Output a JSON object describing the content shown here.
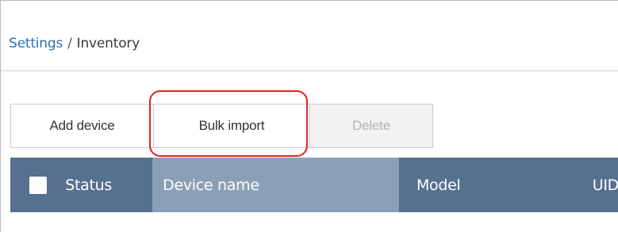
{
  "breadcrumb": {
    "parent": "Settings",
    "separator": "/",
    "current": "Inventory"
  },
  "toolbar": {
    "add_label": "Add device",
    "bulk_label": "Bulk import",
    "delete_label": "Delete"
  },
  "table": {
    "columns": [
      "Status",
      "Device name",
      "Model",
      "UID"
    ]
  },
  "colors": {
    "header_bg": "#56708f",
    "highlighted_column_bg": "#8b9fb6",
    "highlight_ring": "#e02424"
  }
}
